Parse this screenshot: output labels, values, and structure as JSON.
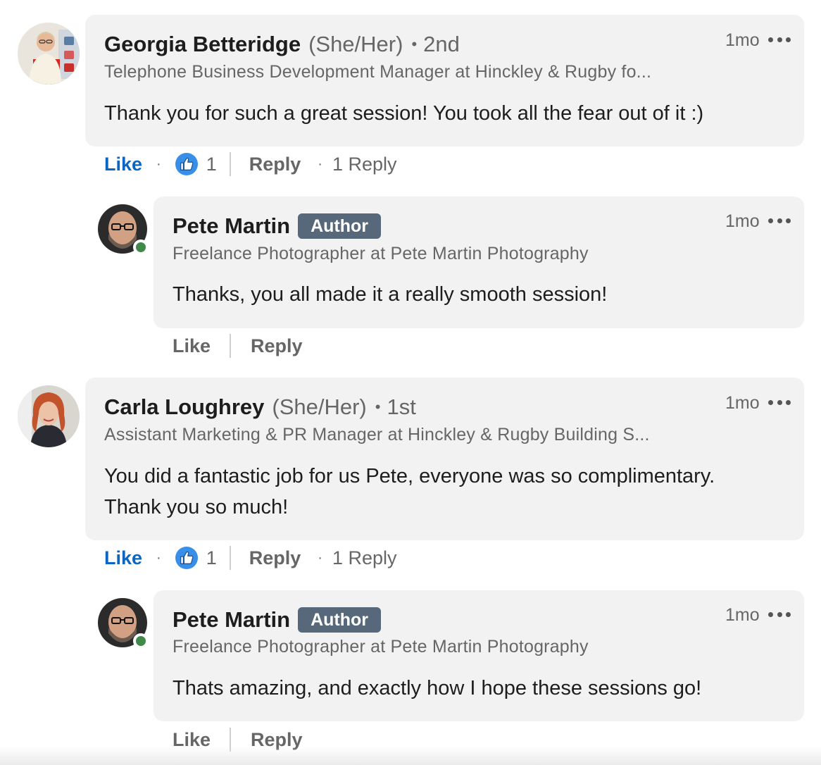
{
  "comments": [
    {
      "name": "Georgia Betteridge",
      "pronouns": "(She/Her)",
      "degree_sep": "•",
      "degree": "2nd",
      "headline": "Telephone Business Development Manager at Hinckley & Rugby fo...",
      "time": "1mo",
      "text": "Thank you for such a great session! You took all the fear out of it :)",
      "like_label": "Like",
      "reaction_count": "1",
      "reply_label": "Reply",
      "replies_label": "1 Reply",
      "reply": {
        "name": "Pete Martin",
        "badge": "Author",
        "headline": "Freelance Photographer at Pete Martin Photography",
        "time": "1mo",
        "text": "Thanks, you all made it a really smooth session!",
        "like_label": "Like",
        "reply_label": "Reply"
      }
    },
    {
      "name": "Carla Loughrey",
      "pronouns": "(She/Her)",
      "degree_sep": "•",
      "degree": "1st",
      "headline": "Assistant Marketing & PR Manager at Hinckley & Rugby Building S...",
      "time": "1mo",
      "text_line1": "You did a fantastic job for us Pete, everyone was so complimentary.",
      "text_line2": "Thank you so much!",
      "like_label": "Like",
      "reaction_count": "1",
      "reply_label": "Reply",
      "replies_label": "1 Reply",
      "reply": {
        "name": "Pete Martin",
        "badge": "Author",
        "headline": "Freelance Photographer at Pete Martin Photography",
        "time": "1mo",
        "text": "Thats amazing, and exactly how I hope these sessions go!",
        "like_label": "Like",
        "reply_label": "Reply"
      }
    }
  ],
  "icons": {
    "more": "more-options-icon",
    "reaction": "like-reaction-icon",
    "presence": "online-status-icon"
  },
  "colors": {
    "bubble": "#f2f2f2",
    "like_blue": "#0a66c2",
    "author_badge": "#56687a",
    "presence_green": "#3f8a4b",
    "reaction_blue": "#378fe9"
  },
  "mid_dot": "·"
}
